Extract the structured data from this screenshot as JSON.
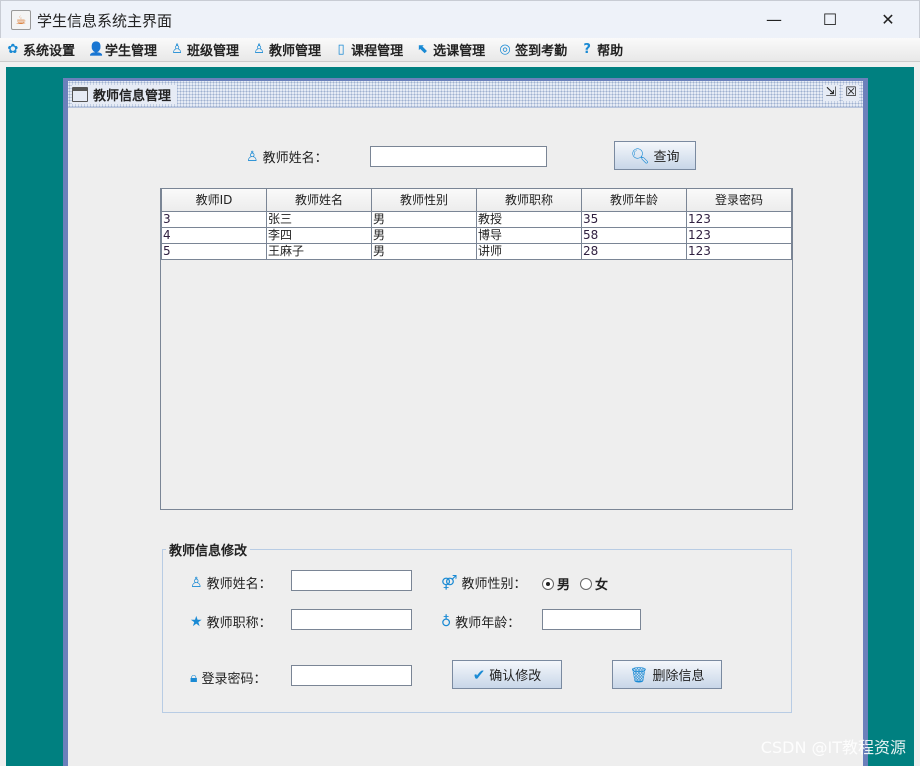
{
  "window": {
    "title": "学生信息系统主界面",
    "minimize": "—",
    "maximize": "☐",
    "close": "✕"
  },
  "menu": [
    {
      "label": "系统设置",
      "icon": "gear-icon",
      "glyph": "✿"
    },
    {
      "label": "学生管理",
      "icon": "student-icon",
      "glyph": "👤"
    },
    {
      "label": "班级管理",
      "icon": "class-icon",
      "glyph": "♙"
    },
    {
      "label": "教师管理",
      "icon": "teacher-icon",
      "glyph": "♙"
    },
    {
      "label": "课程管理",
      "icon": "book-icon",
      "glyph": "▯"
    },
    {
      "label": "选课管理",
      "icon": "cursor-icon",
      "glyph": "⬉"
    },
    {
      "label": "签到考勤",
      "icon": "attendance-icon",
      "glyph": "◎"
    },
    {
      "label": "帮助",
      "icon": "help-icon",
      "glyph": "?"
    }
  ],
  "internal_frame": {
    "title": "教师信息管理",
    "restore": "⇲",
    "close": "☒"
  },
  "search": {
    "label": "教师姓名：",
    "value": "",
    "button": "查询"
  },
  "table": {
    "columns": [
      "教师ID",
      "教师姓名",
      "教师性别",
      "教师职称",
      "教师年龄",
      "登录密码"
    ],
    "rows": [
      [
        "3",
        "张三",
        "男",
        "教授",
        "35",
        "123"
      ],
      [
        "4",
        "李四",
        "男",
        "博导",
        "58",
        "123"
      ],
      [
        "5",
        "王麻子",
        "男",
        "讲师",
        "28",
        "123"
      ]
    ]
  },
  "edit": {
    "title": "教师信息修改",
    "name_label": "教师姓名：",
    "name_value": "",
    "gender_label": "教师性别：",
    "gender_male": "男",
    "gender_female": "女",
    "gender_selected": "男",
    "title_label": "教师职称：",
    "title_value": "",
    "age_label": "教师年龄：",
    "age_value": "",
    "password_label": "登录密码：",
    "password_value": "",
    "confirm_button": "确认修改",
    "delete_button": "删除信息"
  },
  "watermark": "CSDN @IT教程资源"
}
